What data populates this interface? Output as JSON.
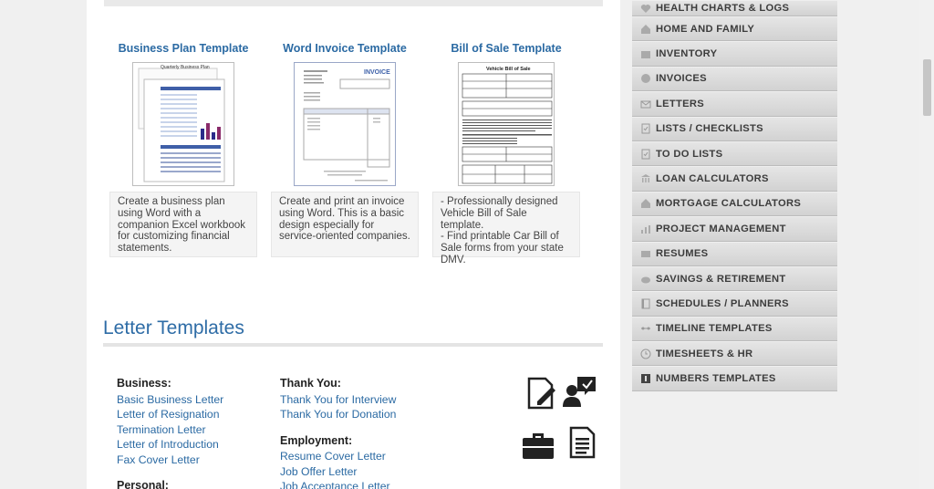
{
  "cards": [
    {
      "title": "Business Plan Template",
      "description": "Create a business plan using Word with a companion Excel workbook for customizing financial statements.",
      "thumb_caption": "Quarterly Business Plan"
    },
    {
      "title": "Word Invoice Template",
      "description": "Create and print an invoice using Word. This is a basic design especially for service-oriented companies.",
      "thumb_caption": "INVOICE"
    },
    {
      "title": "Bill of Sale Template",
      "description": "- Professionally designed Vehicle Bill of Sale template.\n- Find printable Car Bill of Sale forms from your state DMV.",
      "thumb_caption": "Vehicle Bill of Sale"
    }
  ],
  "letters": {
    "title": "Letter Templates",
    "business": {
      "heading": "Business:",
      "links": [
        "Basic Business Letter",
        "Letter of Resignation",
        "Termination Letter",
        "Letter of Introduction",
        "Fax Cover Letter"
      ]
    },
    "personal": {
      "heading": "Personal:"
    },
    "thank_you": {
      "heading": "Thank You:",
      "links": [
        "Thank You for Interview",
        "Thank You for Donation"
      ]
    },
    "employment": {
      "heading": "Employment:",
      "links": [
        "Resume Cover Letter",
        "Job Offer Letter",
        "Job Acceptance Letter"
      ]
    }
  },
  "sidebar": {
    "items": [
      {
        "label": "HEALTH CHARTS & LOGS",
        "icon": "heart-icon"
      },
      {
        "label": "HOME AND FAMILY",
        "icon": "house-icon"
      },
      {
        "label": "INVENTORY",
        "icon": "box-icon"
      },
      {
        "label": "INVOICES",
        "icon": "coin-icon"
      },
      {
        "label": "LETTERS",
        "icon": "envelope-icon"
      },
      {
        "label": "LISTS / CHECKLISTS",
        "icon": "checklist-icon"
      },
      {
        "label": "TO DO LISTS",
        "icon": "todo-icon"
      },
      {
        "label": "LOAN CALCULATORS",
        "icon": "bank-icon"
      },
      {
        "label": "MORTGAGE CALCULATORS",
        "icon": "house-icon"
      },
      {
        "label": "PROJECT MANAGEMENT",
        "icon": "chart-icon"
      },
      {
        "label": "RESUMES",
        "icon": "resume-icon"
      },
      {
        "label": "SAVINGS & RETIREMENT",
        "icon": "piggy-icon"
      },
      {
        "label": "SCHEDULES / PLANNERS",
        "icon": "planner-icon"
      },
      {
        "label": "TIMELINE TEMPLATES",
        "icon": "timeline-icon"
      },
      {
        "label": "TIMESHEETS & HR",
        "icon": "clock-icon"
      },
      {
        "label": "NUMBERS TEMPLATES",
        "icon": "numbers-icon"
      }
    ]
  },
  "colors": {
    "link": "#2b6aa3",
    "sidebar_bg": "#dcdcdc",
    "heading": "#2e6ca6"
  }
}
